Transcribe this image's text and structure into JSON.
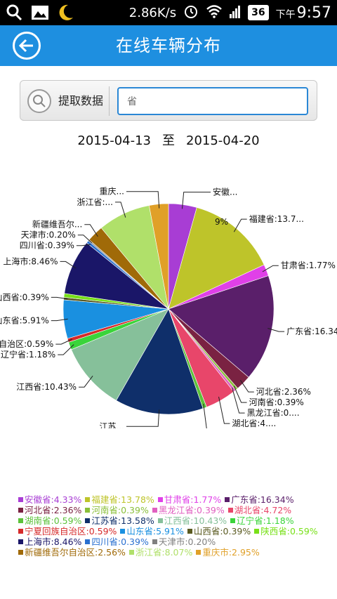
{
  "status_bar": {
    "speed": "2.86K/s",
    "battery": "36",
    "ampm": "下午",
    "time": "9:57"
  },
  "header": {
    "title": "在线车辆分布"
  },
  "search": {
    "fetch_label": "提取数据",
    "placeholder": "省"
  },
  "date_range": {
    "start": "2015-04-13",
    "separator": "至",
    "end": "2015-04-20"
  },
  "chart_data": {
    "type": "pie",
    "slices": [
      {
        "name": "安徽省",
        "value": 4.33,
        "color": "#a83dd4",
        "callout": "安徽..."
      },
      {
        "name": "福建省",
        "value": 13.78,
        "color": "#bec42a",
        "callout": "福建省:13.7..."
      },
      {
        "name": "甘肃省",
        "value": 1.77,
        "color": "#e040e8",
        "callout": "甘肃省:1.77%"
      },
      {
        "name": "广东省",
        "value": 16.34,
        "color": "#5a1f6a",
        "callout": "广东省:16.34%"
      },
      {
        "name": "河北省",
        "value": 2.36,
        "color": "#7a2242",
        "callout": "河北省:2.36%"
      },
      {
        "name": "河南省",
        "value": 0.39,
        "color": "#8abf3a",
        "callout": "河南省:0.39%"
      },
      {
        "name": "黑龙江省",
        "value": 0.39,
        "color": "#e060c0",
        "callout": "黑龙江省:0...."
      },
      {
        "name": "湖北省",
        "value": 4.72,
        "color": "#e8466a",
        "callout": "湖北省:4...."
      },
      {
        "name": "湖南省",
        "value": 0.59,
        "color": "#5cc23a",
        "callout": "湖南省..."
      },
      {
        "name": "江苏省",
        "value": 13.58,
        "color": "#0f2f6a",
        "callout": "江苏..."
      },
      {
        "name": "江西省",
        "value": 10.43,
        "color": "#86c09a",
        "callout": "江西省:10.43%"
      },
      {
        "name": "辽宁省",
        "value": 1.18,
        "color": "#3ad43a",
        "callout": "辽宁省:1.18%"
      },
      {
        "name": "宁夏回族自治区",
        "value": 0.59,
        "color": "#d62a2a",
        "callout": "宁夏回族自治区:0.59%"
      },
      {
        "name": "山东省",
        "value": 5.91,
        "color": "#1a90e0",
        "callout": "山东省:5.91%"
      },
      {
        "name": "山西省",
        "value": 0.39,
        "color": "#5a5a20",
        "callout": "山西省:0.39%"
      },
      {
        "name": "陕西省",
        "value": 0.59,
        "color": "#78e018",
        "callout": ""
      },
      {
        "name": "上海市",
        "value": 8.46,
        "color": "#1a1668",
        "callout": "上海市:8.46%"
      },
      {
        "name": "四川省",
        "value": 0.39,
        "color": "#2a70d0",
        "callout": "四川省:0.39%"
      },
      {
        "name": "天津市",
        "value": 0.2,
        "color": "#808080",
        "callout": "天津市:0.20%"
      },
      {
        "name": "新疆维吾尔自治区",
        "value": 2.56,
        "color": "#a06a08",
        "callout": "新疆维吾尔..."
      },
      {
        "name": "浙江省",
        "value": 8.07,
        "color": "#b0e06a",
        "callout": "浙江省:..."
      },
      {
        "name": "重庆市",
        "value": 2.95,
        "color": "#e0a028",
        "callout": "重庆..."
      }
    ],
    "extra_callout": "9%"
  },
  "legend": {
    "rows": [
      [
        {
          "label": "安徽省:4.33%",
          "color": "#a83dd4"
        },
        {
          "label": "福建省:13.78%",
          "color": "#bec42a"
        },
        {
          "label": "甘肃省:1.77%",
          "color": "#e040e8"
        },
        {
          "label": "广东省:16.34%",
          "color": "#5a1f6a"
        }
      ],
      [
        {
          "label": "河北省:2.36%",
          "color": "#7a2242"
        },
        {
          "label": "河南省:0.39%",
          "color": "#8abf3a"
        },
        {
          "label": "黑龙江省:0.39%",
          "color": "#e060c0"
        },
        {
          "label": "湖北省:4.72%",
          "color": "#e8466a"
        }
      ],
      [
        {
          "label": "湖南省:0.59%",
          "color": "#5cc23a"
        },
        {
          "label": "江苏省:13.58%",
          "color": "#0f2f6a"
        },
        {
          "label": "江西省:10.43%",
          "color": "#86c09a"
        },
        {
          "label": "辽宁省:1.18%",
          "color": "#3ad43a"
        }
      ],
      [
        {
          "label": "宁夏回族自治区:0.59%",
          "color": "#d62a2a"
        },
        {
          "label": "山东省:5.91%",
          "color": "#1a90e0"
        },
        {
          "label": "山西省:0.39%",
          "color": "#5a5a20"
        },
        {
          "label": "陕西省:0.59%",
          "color": "#78e018"
        }
      ],
      [
        {
          "label": "上海市:8.46%",
          "color": "#1a1668"
        },
        {
          "label": "四川省:0.39%",
          "color": "#2a70d0"
        },
        {
          "label": "天津市:0.20%",
          "color": "#808080"
        }
      ],
      [
        {
          "label": "新疆维吾尔自治区:2.56%",
          "color": "#a06a08"
        },
        {
          "label": "浙江省:8.07%",
          "color": "#b0e06a"
        },
        {
          "label": "重庆市:2.95%",
          "color": "#e0a028"
        }
      ]
    ]
  }
}
